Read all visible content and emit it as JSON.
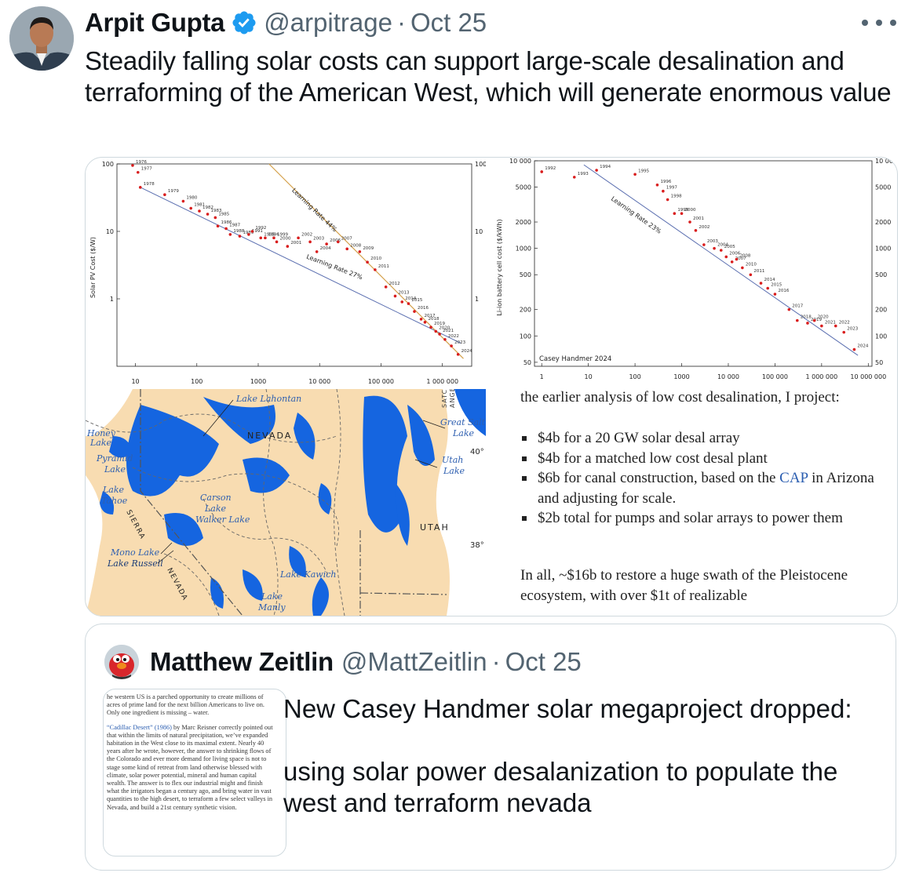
{
  "tweet": {
    "author_name": "Arpit Gupta",
    "handle": "@arpitrage",
    "date_sep": "·",
    "date": "Oct 25",
    "text": "Steadily falling solar costs can support large-scale desalination and terraforming of the American West, which will generate enormous value",
    "icons": {
      "verified": "verified-badge-icon",
      "more": "more-options-icon"
    },
    "colors": {
      "verified": "#1d9bf0",
      "meta": "#536471"
    }
  },
  "media": {
    "pv_chart": {
      "ylabel": "Solar PV Cost ($/W)",
      "x_ticks": [
        "10",
        "100",
        "1000",
        "10 000",
        "100 000",
        "1 000 000"
      ],
      "y_ticks": [
        "100",
        "10",
        "1"
      ],
      "annotations": [
        "Learning Rate 44%",
        "Learning Rate 27%"
      ]
    },
    "battery_chart": {
      "ylabel": "Li-ion battery cell cost ($/kWh)",
      "x_ticks": [
        "1",
        "10",
        "100",
        "1000",
        "10 000",
        "100 000",
        "1 000 000",
        "10 000 000"
      ],
      "y_ticks": [
        "10 000",
        "5000",
        "2000",
        "1000",
        "500",
        "200",
        "100",
        "50"
      ],
      "annotations": [
        "Learning Rate 23%"
      ],
      "credit": "Casey Handmer 2024"
    },
    "map": {
      "labels": [
        "Lake Lahontan",
        "NEVADA",
        "Honey Lake",
        "Pyramid Lake",
        "Lake Tahoe",
        "Carson Lake",
        "Walker Lake",
        "Mono Lake",
        "Lake Russell",
        "SIERRA",
        "NEVADA",
        "Lake Kawich",
        "Lake Manly",
        "UTAH",
        "Great Salt Lake",
        "Utah Lake",
        "SATCH",
        "ANGE"
      ],
      "latitudes": [
        "40°",
        "38°"
      ]
    },
    "article": {
      "intro": "the earlier analysis of low cost desalination, I project:",
      "bullets": [
        "$4b for a 20 GW solar desal array",
        "$4b for a matched low cost desal plant",
        "$2b total for pumps and solar arrays to power them"
      ],
      "canal_pre": "$6b for canal construction, based on the ",
      "canal_link": "CAP",
      "canal_post": " in Arizona and adjusting for scale.",
      "summary": "In all, ~$16b to restore a huge swath of the Pleistocene ecosystem, with over $1t of realizable"
    }
  },
  "quote": {
    "author_name": "Matthew Zeitlin",
    "handle": "@MattZeitlin",
    "date_sep": "·",
    "date": "Oct 25",
    "text_1": "New Casey Handmer solar megaproject dropped:",
    "text_2": "using solar power desalanization to populate the west and terraform nevada",
    "thumbnail": {
      "para_1": "he western US is a parched opportunity to create millions of acres of prime land for the next billion Americans to live on. Only one ingredient is missing – water.",
      "link": "“Cadillac Desert” (1986)",
      "para_2": " by Marc Reisner correctly pointed out that within the limits of natural precipitation, we’ve expanded habitation in the West close to its maximal extent. Nearly 40 years after he wrote, however, the answer to shrinking flows of the Colorado and ever more demand for living space is not to stage some kind of retreat from land otherwise blessed with climate, solar power potential, mineral and human capital wealth. The answer is to flex our industrial might and finish what the irrigators began a century ago, and bring water in vast quantities to the high desert, to terraform a few select valleys in Nevada, and build a 21st century synthetic vision."
    }
  },
  "chart_data": [
    {
      "type": "scatter",
      "title": "",
      "xlabel": "",
      "ylabel": "Solar PV Cost ($/W)",
      "log_x": true,
      "log_y": true,
      "xlim": [
        5,
        3000000
      ],
      "ylim": [
        0.1,
        100
      ],
      "annotations": [
        "Learning Rate 44%",
        "Learning Rate 27%"
      ],
      "points": [
        {
          "label": "1976",
          "x": 9,
          "y": 95
        },
        {
          "label": "1977",
          "x": 11,
          "y": 75
        },
        {
          "label": "1978",
          "x": 12,
          "y": 45
        },
        {
          "label": "1979",
          "x": 30,
          "y": 35
        },
        {
          "label": "1980",
          "x": 60,
          "y": 28
        },
        {
          "label": "1981",
          "x": 80,
          "y": 22
        },
        {
          "label": "1982",
          "x": 110,
          "y": 20
        },
        {
          "label": "1983",
          "x": 150,
          "y": 18
        },
        {
          "label": "1985",
          "x": 200,
          "y": 16
        },
        {
          "label": "1986",
          "x": 220,
          "y": 12
        },
        {
          "label": "1987",
          "x": 300,
          "y": 11
        },
        {
          "label": "1988",
          "x": 350,
          "y": 9
        },
        {
          "label": "1989",
          "x": 500,
          "y": 8.5
        },
        {
          "label": "1991",
          "x": 700,
          "y": 9
        },
        {
          "label": "1992",
          "x": 800,
          "y": 10
        },
        {
          "label": "1995",
          "x": 1100,
          "y": 8
        },
        {
          "label": "1996",
          "x": 1300,
          "y": 8
        },
        {
          "label": "1999",
          "x": 1800,
          "y": 8
        },
        {
          "label": "2000",
          "x": 2000,
          "y": 7
        },
        {
          "label": "2001",
          "x": 3000,
          "y": 6
        },
        {
          "label": "2002",
          "x": 4500,
          "y": 8
        },
        {
          "label": "2003",
          "x": 7000,
          "y": 7
        },
        {
          "label": "2004",
          "x": 9000,
          "y": 5
        },
        {
          "label": "2006",
          "x": 13000,
          "y": 6.5
        },
        {
          "label": "2007",
          "x": 20000,
          "y": 7
        },
        {
          "label": "2008",
          "x": 28000,
          "y": 5.5
        },
        {
          "label": "2009",
          "x": 45000,
          "y": 5
        },
        {
          "label": "2010",
          "x": 60000,
          "y": 3.5
        },
        {
          "label": "2011",
          "x": 80000,
          "y": 2.7
        },
        {
          "label": "2012",
          "x": 120000,
          "y": 1.5
        },
        {
          "label": "2013",
          "x": 170000,
          "y": 1.1
        },
        {
          "label": "2014",
          "x": 220000,
          "y": 0.9
        },
        {
          "label": "2015",
          "x": 280000,
          "y": 0.85
        },
        {
          "label": "2016",
          "x": 350000,
          "y": 0.65
        },
        {
          "label": "2017",
          "x": 450000,
          "y": 0.5
        },
        {
          "label": "2018",
          "x": 520000,
          "y": 0.45
        },
        {
          "label": "2019",
          "x": 650000,
          "y": 0.38
        },
        {
          "label": "2020",
          "x": 780000,
          "y": 0.33
        },
        {
          "label": "2021",
          "x": 900000,
          "y": 0.3
        },
        {
          "label": "2022",
          "x": 1100000,
          "y": 0.25
        },
        {
          "label": "2023",
          "x": 1400000,
          "y": 0.2
        },
        {
          "label": "2024",
          "x": 1800000,
          "y": 0.15
        }
      ]
    },
    {
      "type": "scatter",
      "title": "",
      "xlabel": "",
      "ylabel": "Li-ion battery cell cost ($/kWh)",
      "log_x": true,
      "log_y": true,
      "xlim": [
        0.7,
        12000000
      ],
      "ylim": [
        45,
        10000
      ],
      "annotations": [
        "Learning Rate 23%",
        "Casey Handmer 2024"
      ],
      "points": [
        {
          "label": "1992",
          "x": 1,
          "y": 7500
        },
        {
          "label": "1993",
          "x": 5,
          "y": 6500
        },
        {
          "label": "1994",
          "x": 15,
          "y": 7800
        },
        {
          "label": "1995",
          "x": 100,
          "y": 7000
        },
        {
          "label": "1996",
          "x": 300,
          "y": 5300
        },
        {
          "label": "1997",
          "x": 400,
          "y": 4500
        },
        {
          "label": "1998",
          "x": 500,
          "y": 3600
        },
        {
          "label": "1999",
          "x": 700,
          "y": 2500
        },
        {
          "label": "2000",
          "x": 1000,
          "y": 2500
        },
        {
          "label": "2001",
          "x": 1500,
          "y": 2000
        },
        {
          "label": "2002",
          "x": 2000,
          "y": 1600
        },
        {
          "label": "2003",
          "x": 3000,
          "y": 1100
        },
        {
          "label": "2004",
          "x": 5000,
          "y": 1000
        },
        {
          "label": "2005",
          "x": 7000,
          "y": 950
        },
        {
          "label": "2006",
          "x": 9000,
          "y": 800
        },
        {
          "label": "2007",
          "x": 12000,
          "y": 700
        },
        {
          "label": "2008",
          "x": 15000,
          "y": 750
        },
        {
          "label": "2010",
          "x": 20000,
          "y": 600
        },
        {
          "label": "2011",
          "x": 30000,
          "y": 500
        },
        {
          "label": "2014",
          "x": 50000,
          "y": 400
        },
        {
          "label": "2015",
          "x": 70000,
          "y": 350
        },
        {
          "label": "2016",
          "x": 100000,
          "y": 300
        },
        {
          "label": "2017",
          "x": 200000,
          "y": 200
        },
        {
          "label": "2018",
          "x": 300000,
          "y": 150
        },
        {
          "label": "2019",
          "x": 500000,
          "y": 140
        },
        {
          "label": "2020",
          "x": 700000,
          "y": 150
        },
        {
          "label": "2021",
          "x": 1000000,
          "y": 130
        },
        {
          "label": "2022",
          "x": 2000000,
          "y": 130
        },
        {
          "label": "2023",
          "x": 3000000,
          "y": 110
        },
        {
          "label": "2024",
          "x": 5000000,
          "y": 70
        }
      ]
    }
  ]
}
